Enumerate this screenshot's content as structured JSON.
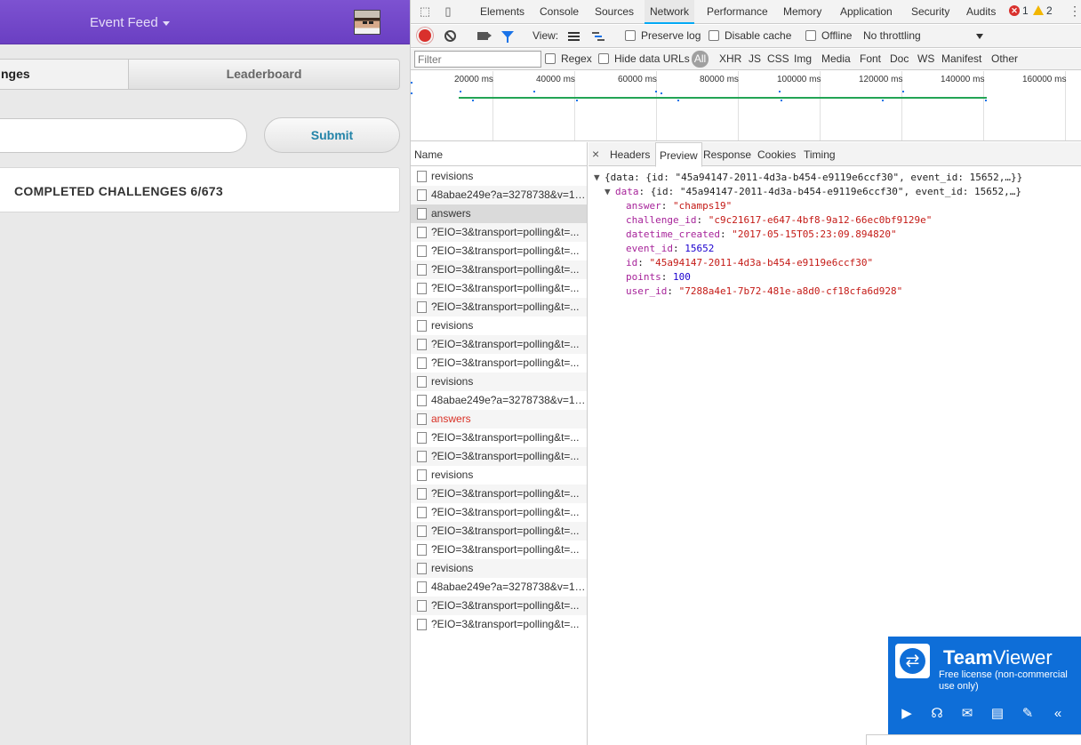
{
  "app": {
    "header": {
      "title": "Event Feed"
    },
    "tabs": [
      {
        "label": "nges"
      },
      {
        "label": "Leaderboard"
      }
    ],
    "answer_input": {
      "value": "",
      "placeholder": ""
    },
    "submit_label": "Submit",
    "completed_label": "COMPLETED CHALLENGES 6/673"
  },
  "devtools": {
    "panel_tabs": [
      "Elements",
      "Console",
      "Sources",
      "Network",
      "Performance",
      "Memory",
      "Application",
      "Security",
      "Audits"
    ],
    "active_panel": "Network",
    "error_count": "1",
    "warning_count": "2",
    "error_badge": "✕",
    "network_toolbar": {
      "view_label": "View:",
      "preserve_log": "Preserve log",
      "disable_cache": "Disable cache",
      "offline": "Offline",
      "throttling": "No throttling"
    },
    "filter_bar": {
      "filter_placeholder": "Filter",
      "regex": "Regex",
      "hide_data_urls": "Hide data URLs",
      "types": [
        "All",
        "XHR",
        "JS",
        "CSS",
        "Img",
        "Media",
        "Font",
        "Doc",
        "WS",
        "Manifest",
        "Other"
      ]
    },
    "overview": {
      "ticks": [
        "20000 ms",
        "40000 ms",
        "60000 ms",
        "80000 ms",
        "100000 ms",
        "120000 ms",
        "140000 ms",
        "160000 ms"
      ]
    },
    "name_column_header": "Name",
    "requests": [
      {
        "name": "revisions"
      },
      {
        "name": "48abae249e?a=3278738&v=10..."
      },
      {
        "name": "answers",
        "selected": true
      },
      {
        "name": "?EIO=3&transport=polling&t=..."
      },
      {
        "name": "?EIO=3&transport=polling&t=..."
      },
      {
        "name": "?EIO=3&transport=polling&t=..."
      },
      {
        "name": "?EIO=3&transport=polling&t=..."
      },
      {
        "name": "?EIO=3&transport=polling&t=..."
      },
      {
        "name": "revisions"
      },
      {
        "name": "?EIO=3&transport=polling&t=..."
      },
      {
        "name": "?EIO=3&transport=polling&t=..."
      },
      {
        "name": "revisions"
      },
      {
        "name": "48abae249e?a=3278738&v=10..."
      },
      {
        "name": "answers",
        "error": true
      },
      {
        "name": "?EIO=3&transport=polling&t=..."
      },
      {
        "name": "?EIO=3&transport=polling&t=..."
      },
      {
        "name": "revisions"
      },
      {
        "name": "?EIO=3&transport=polling&t=..."
      },
      {
        "name": "?EIO=3&transport=polling&t=..."
      },
      {
        "name": "?EIO=3&transport=polling&t=..."
      },
      {
        "name": "?EIO=3&transport=polling&t=..."
      },
      {
        "name": "revisions"
      },
      {
        "name": "48abae249e?a=3278738&v=10..."
      },
      {
        "name": "?EIO=3&transport=polling&t=..."
      },
      {
        "name": "?EIO=3&transport=polling&t=..."
      }
    ],
    "detail_tabs": [
      "Headers",
      "Preview",
      "Response",
      "Cookies",
      "Timing"
    ],
    "active_detail_tab": "Preview",
    "close_glyph": "×",
    "preview": {
      "root_summary": "{data: {id: \"45a94147-2011-4d3a-b454-e9119e6ccf30\", event_id: 15652,…}}",
      "data_key": "data",
      "data_summary": "{id: \"45a94147-2011-4d3a-b454-e9119e6ccf30\", event_id: 15652,…}",
      "fields": [
        {
          "key": "answer",
          "value": "\"champs19\"",
          "kind": "string"
        },
        {
          "key": "challenge_id",
          "value": "\"c9c21617-e647-4bf8-9a12-66ec0bf9129e\"",
          "kind": "string"
        },
        {
          "key": "datetime_created",
          "value": "\"2017-05-15T05:23:09.894820\"",
          "kind": "string"
        },
        {
          "key": "event_id",
          "value": "15652",
          "kind": "number"
        },
        {
          "key": "id",
          "value": "\"45a94147-2011-4d3a-b454-e9119e6ccf30\"",
          "kind": "string"
        },
        {
          "key": "points",
          "value": "100",
          "kind": "number"
        },
        {
          "key": "user_id",
          "value": "\"7288a4e1-7b72-481e-a8d0-cf18cfa6d928\"",
          "kind": "string"
        }
      ]
    }
  },
  "teamviewer": {
    "title_bold": "Team",
    "title_rest": "Viewer",
    "license": "Free license (non-commercial use only)",
    "icons": [
      "video-icon",
      "headset-icon",
      "chat-icon",
      "file-transfer-icon",
      "brush-icon",
      "collapse-icon"
    ]
  }
}
